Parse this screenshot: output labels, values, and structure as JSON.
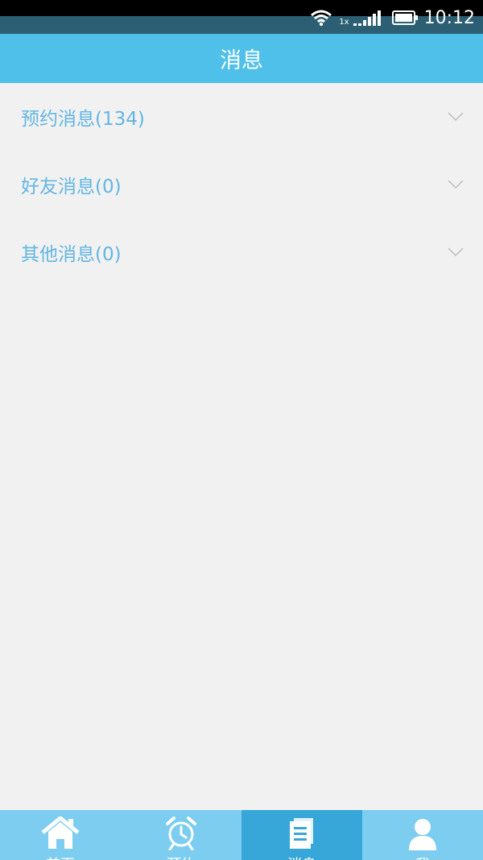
{
  "status_bar": {
    "time": "10:12",
    "sim_label": "1x",
    "icons": [
      "wifi-icon",
      "signal-icon",
      "battery-icon"
    ]
  },
  "header": {
    "title": "消息"
  },
  "message_groups": [
    {
      "label": "预约消息(134)",
      "icon": "chevron-down-icon"
    },
    {
      "label": "好友消息(0)",
      "icon": "chevron-down-icon"
    },
    {
      "label": "其他消息(0)",
      "icon": "chevron-down-icon"
    }
  ],
  "bottom_nav": {
    "items": [
      {
        "icon": "home-icon",
        "label": "首页"
      },
      {
        "icon": "alarm-clock-icon",
        "label": "预约"
      },
      {
        "icon": "document-icon",
        "label": "消息",
        "active": true
      },
      {
        "icon": "user-icon",
        "label": "我"
      }
    ]
  },
  "colors": {
    "accent": "#4ec0e9",
    "nav_bg": "#7ccdf0",
    "nav_active": "#37a7d9",
    "label": "#62b6e3",
    "background": "#f1f1f1"
  }
}
